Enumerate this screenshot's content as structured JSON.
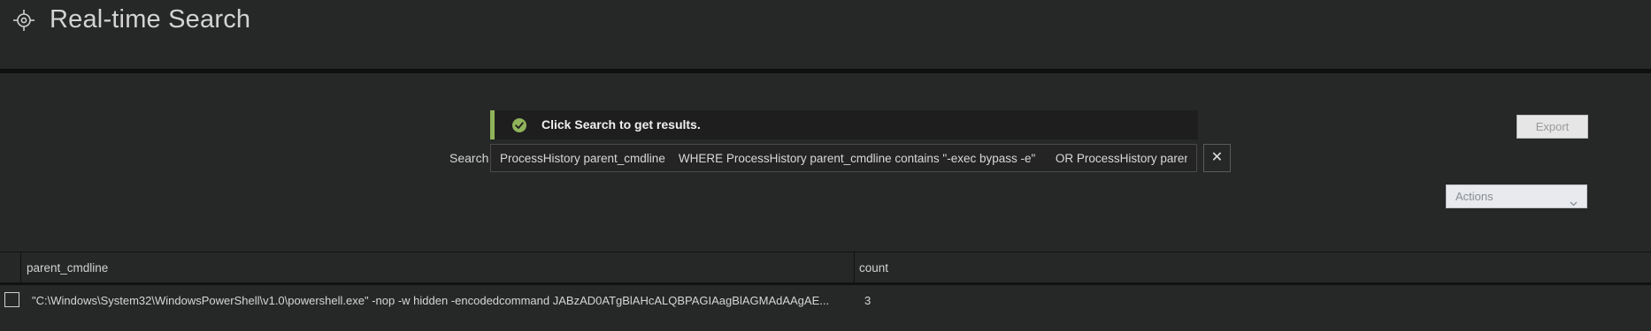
{
  "header": {
    "title": "Real-time Search",
    "icon": "target-crosshair-icon"
  },
  "notice": {
    "text": "Click Search to get results.",
    "status_color": "#8fb35a"
  },
  "search": {
    "label": "Search",
    "query": "ProcessHistory parent_cmdline    WHERE ProcessHistory parent_cmdline contains \"-exec bypass -e\"      OR ProcessHistory parent_cmdline contains \"-nop -w hidden\"",
    "clear_label": "✕"
  },
  "toolbar": {
    "export_label": "Export",
    "actions_label": "Actions"
  },
  "table": {
    "columns": [
      "parent_cmdline",
      "count"
    ],
    "rows": [
      {
        "parent_cmdline": "\"C:\\Windows\\System32\\WindowsPowerShell\\v1.0\\powershell.exe\" -nop -w hidden -encodedcommand JABzAD0ATgBlAHcALQBPAGIAagBlAGMAdAAgAE...",
        "count": "3"
      }
    ]
  }
}
